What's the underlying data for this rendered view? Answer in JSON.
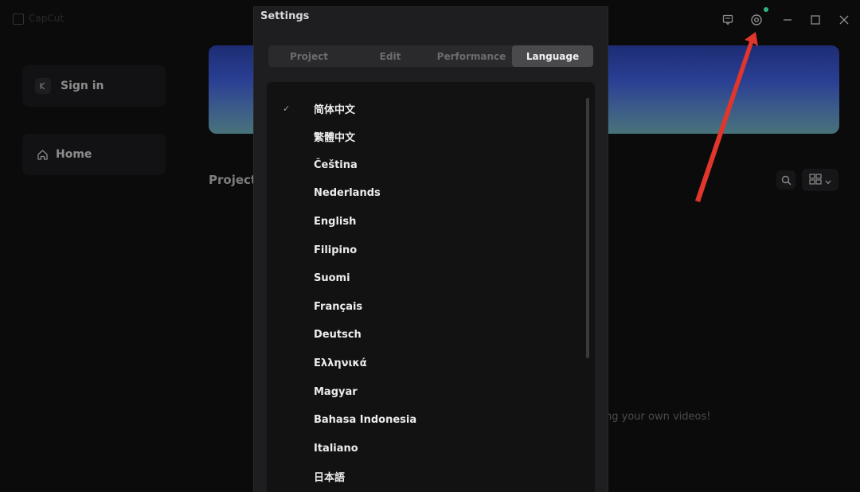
{
  "app": {
    "window_title": "CapCut",
    "titlebar_icons": [
      "feedback-icon",
      "settings-gear-icon",
      "minimize-icon",
      "maximize-icon",
      "close-icon"
    ]
  },
  "sidebar": {
    "signin_label": "Sign in",
    "home_label": "Home"
  },
  "main": {
    "projects_title": "Projects",
    "empty_hint": "ng your own videos!"
  },
  "settings": {
    "title": "Settings",
    "tabs": [
      {
        "label": "Project"
      },
      {
        "label": "Edit"
      },
      {
        "label": "Performance"
      },
      {
        "label": "Language"
      }
    ],
    "active_tab": "Language",
    "selected_language": "简体中文",
    "languages": [
      "简体中文",
      "繁體中文",
      "Čeština",
      "Nederlands",
      "English",
      "Filipino",
      "Suomi",
      "Français",
      "Deutsch",
      "Ελληνικά",
      "Magyar",
      "Bahasa Indonesia",
      "Italiano",
      "日本語"
    ]
  },
  "colors": {
    "annotation_arrow": "#e0362b",
    "notification_dot": "#2fb37c",
    "active_tab_bg": "#4a4a4d"
  }
}
